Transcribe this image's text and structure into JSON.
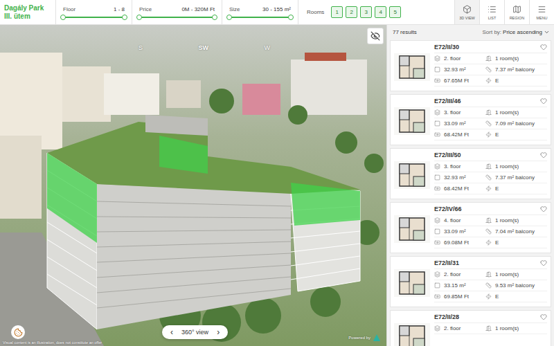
{
  "logo": {
    "name": "Dagály Park",
    "phase": "III. ütem"
  },
  "filters": [
    {
      "label": "Floor",
      "value": "1 - 8",
      "unit": "",
      "level_from": 0,
      "level_to": 1
    },
    {
      "label": "Price",
      "value": "0M - 320M",
      "unit": "Ft",
      "level_from": 0,
      "level_to": 1
    },
    {
      "label": "Size",
      "value": "30 - 155",
      "unit": "m²",
      "level_from": 0,
      "level_to": 1
    }
  ],
  "rooms": {
    "label": "Rooms",
    "options": [
      {
        "label": "1",
        "selected": true
      },
      {
        "label": "2",
        "selected": true
      },
      {
        "label": "3",
        "selected": true
      },
      {
        "label": "4",
        "selected": true
      },
      {
        "label": "5",
        "selected": true
      }
    ]
  },
  "views": [
    {
      "label": "3D VIEW",
      "kind": "3d",
      "selected": true
    },
    {
      "label": "LIST",
      "kind": "list",
      "selected": false
    },
    {
      "label": "REGION",
      "kind": "region",
      "selected": false
    },
    {
      "label": "MENU",
      "kind": "menu",
      "selected": false
    }
  ],
  "scene": {
    "compass": [
      "S",
      "SW",
      "W"
    ],
    "view_button": {
      "prev": "‹",
      "label": "360° view",
      "next": "›"
    },
    "disclaimer": "Visual content is an illustration, does not constitute an offer",
    "powered_by": "Powered by"
  },
  "results": {
    "count": "77 results",
    "sort_label": "Sort by:",
    "sort_value": "Price ascending"
  },
  "listings": [
    {
      "title": "E72/II/30",
      "favorite": false,
      "floor": "2. floor",
      "rooms": "1 room(s)",
      "size": "32.93 m²",
      "balcony": "7.37 m² balcony",
      "price": "67.65M Ft",
      "energy": "E"
    },
    {
      "title": "E72/III/46",
      "favorite": false,
      "floor": "3. floor",
      "rooms": "1 room(s)",
      "size": "33.09 m²",
      "balcony": "7.09 m² balcony",
      "price": "68.42M Ft",
      "energy": "E"
    },
    {
      "title": "E72/III/50",
      "favorite": false,
      "floor": "3. floor",
      "rooms": "1 room(s)",
      "size": "32.93 m²",
      "balcony": "7.37 m² balcony",
      "price": "68.42M Ft",
      "energy": "E"
    },
    {
      "title": "E72/IV/66",
      "favorite": false,
      "floor": "4. floor",
      "rooms": "1 room(s)",
      "size": "33.09 m²",
      "balcony": "7.04 m² balcony",
      "price": "69.08M Ft",
      "energy": "E"
    },
    {
      "title": "E72/II/31",
      "favorite": false,
      "floor": "2. floor",
      "rooms": "1 room(s)",
      "size": "33.15 m²",
      "balcony": "9.53 m² balcony",
      "price": "69.85M Ft",
      "energy": "E"
    },
    {
      "title": "E72/II/28",
      "favorite": false,
      "floor": "2. floor",
      "rooms": "1 room(s)"
    }
  ]
}
